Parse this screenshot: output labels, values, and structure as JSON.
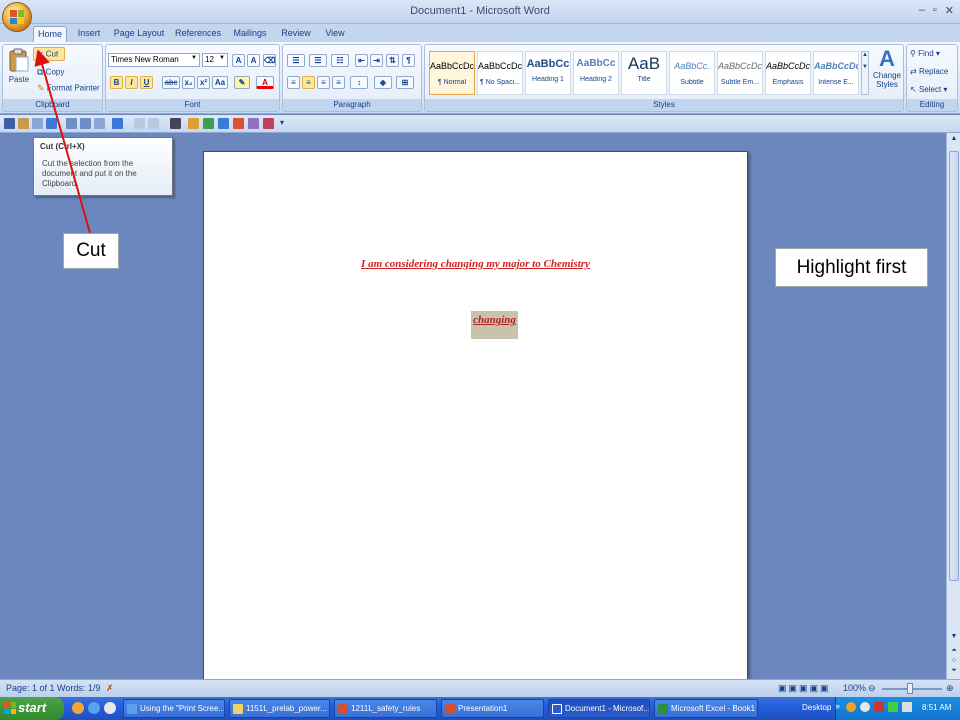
{
  "window": {
    "title": "Document1 - Microsoft Word",
    "minimize": "–",
    "restore": "▫",
    "close": "✕"
  },
  "tabs": [
    "Home",
    "Insert",
    "Page Layout",
    "References",
    "Mailings",
    "Review",
    "View"
  ],
  "clipboard": {
    "paste": "Paste",
    "cut": "Cut",
    "copy": "Copy",
    "format_painter": "Format Painter",
    "label": "Clipboard"
  },
  "font": {
    "family": "Times New Roman",
    "size": "12",
    "label": "Font",
    "bold": "B",
    "italic": "I",
    "underline": "U",
    "strike": "abc",
    "subscript": "x₂",
    "superscript": "x²",
    "change_case": "Aa",
    "font_color": "A",
    "grow": "A",
    "shrink": "A"
  },
  "paragraph": {
    "label": "Paragraph"
  },
  "styles": {
    "label": "Styles",
    "items": [
      {
        "sample": "AaBbCcDc",
        "name": "¶ Normal"
      },
      {
        "sample": "AaBbCcDc",
        "name": "¶ No Spaci..."
      },
      {
        "sample": "AaBbCc",
        "name": "Heading 1"
      },
      {
        "sample": "AaBbCc",
        "name": "Heading 2"
      },
      {
        "sample": "AaB",
        "name": "Title"
      },
      {
        "sample": "AaBbCc.",
        "name": "Subtitle"
      },
      {
        "sample": "AaBbCcDc",
        "name": "Subtle Em..."
      },
      {
        "sample": "AaBbCcDc",
        "name": "Emphasis"
      },
      {
        "sample": "AaBbCcDc",
        "name": "Intense E..."
      }
    ],
    "change_styles": "Change Styles"
  },
  "editing": {
    "label": "Editing",
    "find": "Find",
    "replace": "Replace",
    "select": "Select"
  },
  "tooltip": {
    "title": "Cut (Ctrl+X)",
    "body": "Cut the selection from the document and put it on the Clipboard."
  },
  "document": {
    "line1": "I am considering changing my major to Chemistry",
    "highlighted_word": "changing"
  },
  "callouts": {
    "cut": "Cut",
    "highlight": "Highlight first"
  },
  "status": {
    "page": "Page: 1 of 1",
    "words": "Words: 1/9",
    "zoom": "100%"
  },
  "taskbar": {
    "start": "start",
    "tasks": [
      "Using the \"Print Scree...",
      "1151L_prelab_power...",
      "1211L_safety_rules",
      "Presentation1",
      "Document1 - Microsof...",
      "Microsoft Excel - Book1"
    ],
    "desktop": "Desktop",
    "time": "8:51 AM"
  }
}
